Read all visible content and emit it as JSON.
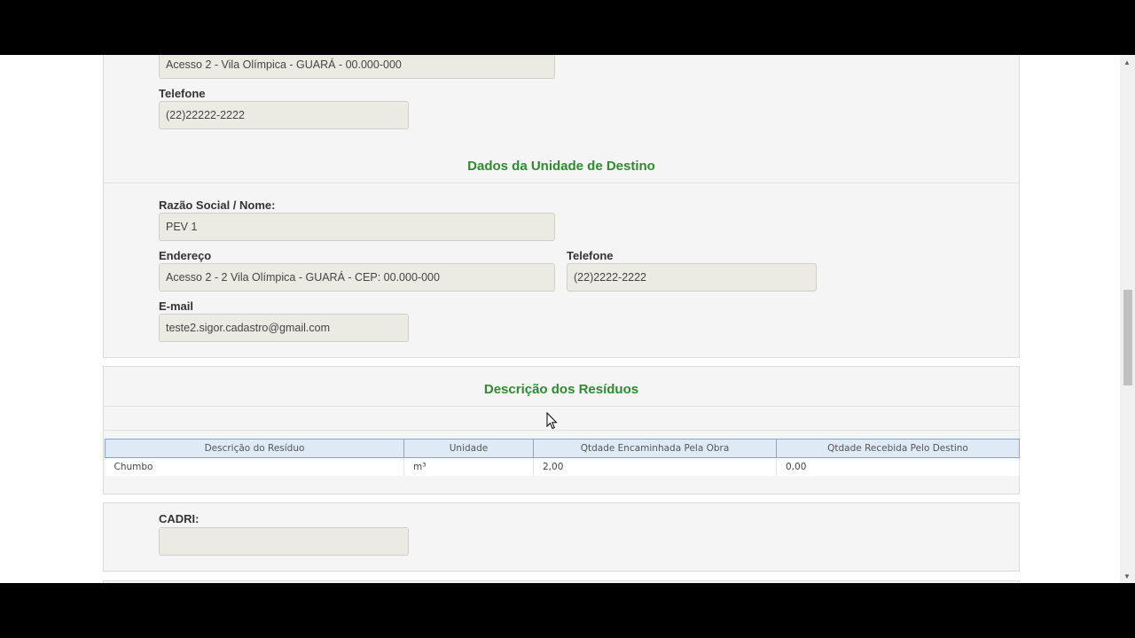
{
  "origin_section": {
    "address_value": "Acesso 2 -  Vila Olímpica - GUARÁ - 00.000-000",
    "phone_label": "Telefone",
    "phone_value": "(22)22222-2222"
  },
  "destination_section": {
    "title": "Dados da Unidade de Destino",
    "name_label": "Razão Social / Nome:",
    "name_value": "PEV 1",
    "address_label": "Endereço",
    "address_value": "Acesso 2 - 2 Vila Olímpica - GUARÁ - CEP: 00.000-000",
    "phone_label": "Telefone",
    "phone_value": "(22)2222-2222",
    "email_label": "E-mail",
    "email_value": "teste2.sigor.cadastro@gmail.com"
  },
  "waste_section": {
    "title": "Descrição dos Resíduos",
    "columns": [
      "Descrição do Resíduo",
      "Unidade",
      "Qtdade Encaminhada Pela Obra",
      "Qtdade Recebida Pelo Destino"
    ],
    "rows": [
      [
        "Chumbo",
        "m³",
        "2,00",
        "0,00"
      ]
    ]
  },
  "cadri_section": {
    "label": "CADRI:",
    "value": ""
  },
  "icons": [
    "scroll-up-arrow-icon",
    "scroll-down-arrow-icon",
    "mouse-cursor-icon"
  ]
}
